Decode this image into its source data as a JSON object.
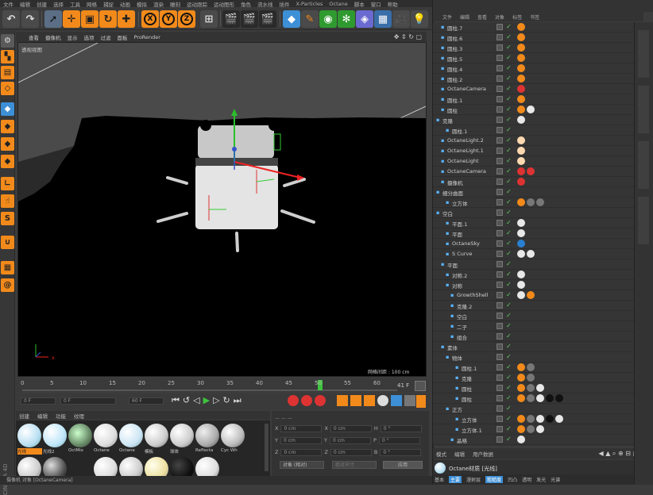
{
  "menubar": {
    "items": [
      "文件",
      "编辑",
      "创建",
      "选择",
      "工具",
      "网格",
      "捕捉",
      "动画",
      "模拟",
      "渲染",
      "雕刻",
      "运动跟踪",
      "运动图形",
      "角色",
      "流水线",
      "插件",
      "X-Particles",
      "Octane",
      "脚本",
      "窗口",
      "帮助"
    ],
    "layout_label": "界面",
    "layout_value": "启动"
  },
  "viewport": {
    "menu": [
      "查看",
      "摄像机",
      "显示",
      "选项",
      "过滤",
      "面板",
      "ProRender"
    ],
    "name": "透视视图",
    "grid_label": "网格间距 : 100 cm"
  },
  "timeline": {
    "ticks": [
      "0",
      "5",
      "10",
      "15",
      "20",
      "25",
      "30",
      "35",
      "40",
      "45",
      "50",
      "55",
      "60"
    ],
    "current_frame": "41 F",
    "start": "0 F",
    "min": "0 F",
    "max": "60 F",
    "end": "60 F"
  },
  "materials": {
    "tabs": [
      "创建",
      "编辑",
      "功能",
      "纹理"
    ],
    "row1": [
      "光线",
      "光线2",
      "OctMix",
      "Octane",
      "Octane",
      "模板",
      "球体",
      "Reflecta",
      "Cyc Wh"
    ]
  },
  "coords": {
    "rows": [
      {
        "a": "X",
        "v1": "0 cm",
        "b": "X",
        "v2": "0 cm",
        "c": "H",
        "v3": "0 °"
      },
      {
        "a": "Y",
        "v1": "0 cm",
        "b": "Y",
        "v2": "0 cm",
        "c": "P",
        "v3": "0 °"
      },
      {
        "a": "Z",
        "v1": "0 cm",
        "b": "Z",
        "v2": "0 cm",
        "c": "B",
        "v3": "0 °"
      }
    ],
    "mode": "对象 (相对)",
    "size_mode": "绝对尺寸",
    "apply": "应用"
  },
  "objects": {
    "menu": [
      "文件",
      "编辑",
      "查看",
      "对象",
      "标签",
      "书签"
    ],
    "rows": [
      {
        "name": "圆柱.7",
        "indent": 8,
        "tags": "o"
      },
      {
        "name": "圆柱.6",
        "indent": 8,
        "tags": "o"
      },
      {
        "name": "圆柱.3",
        "indent": 8,
        "tags": "o"
      },
      {
        "name": "圆柱.5",
        "indent": 8,
        "tags": "o"
      },
      {
        "name": "圆柱.4",
        "indent": 8,
        "tags": "o"
      },
      {
        "name": "圆柱.2",
        "indent": 8,
        "tags": "o"
      },
      {
        "name": "OctaneCamera",
        "indent": 8,
        "tags": "r"
      },
      {
        "name": "圆柱.1",
        "indent": 8,
        "tags": "o"
      },
      {
        "name": "圆柱",
        "indent": 8,
        "tags": "ow"
      },
      {
        "name": "克隆",
        "indent": 2,
        "tags": "w"
      },
      {
        "name": "圆柱.1",
        "indent": 14,
        "tags": ""
      },
      {
        "name": "OctaneLight.2",
        "indent": 8,
        "tags": "l"
      },
      {
        "name": "OctaneLight.1",
        "indent": 8,
        "tags": "l"
      },
      {
        "name": "OctaneLight",
        "indent": 8,
        "tags": "l"
      },
      {
        "name": "OctaneCamera",
        "indent": 8,
        "tags": "rr"
      },
      {
        "name": "摄像机",
        "indent": 8,
        "tags": "r"
      },
      {
        "name": "细分曲面",
        "indent": 2,
        "tags": ""
      },
      {
        "name": "立方体",
        "indent": 14,
        "tags": "ogg"
      },
      {
        "name": "空白",
        "indent": 2,
        "tags": ""
      },
      {
        "name": "平面.1",
        "indent": 14,
        "tags": "w"
      },
      {
        "name": "平面",
        "indent": 14,
        "tags": "w"
      },
      {
        "name": "OctaneSky",
        "indent": 14,
        "tags": "b"
      },
      {
        "name": "S Curve",
        "indent": 14,
        "tags": "ww"
      },
      {
        "name": "平面",
        "indent": 8,
        "tags": ""
      },
      {
        "name": "对称.2",
        "indent": 14,
        "tags": "w"
      },
      {
        "name": "对称",
        "indent": 14,
        "tags": "w"
      },
      {
        "name": "GrowthShell",
        "indent": 20,
        "tags": "wo"
      },
      {
        "name": "克隆.2",
        "indent": 20,
        "tags": ""
      },
      {
        "name": "空白",
        "indent": 20,
        "tags": ""
      },
      {
        "name": "二子",
        "indent": 20,
        "tags": ""
      },
      {
        "name": "组合",
        "indent": 20,
        "tags": ""
      },
      {
        "name": "素体",
        "indent": 8,
        "tags": ""
      },
      {
        "name": "物体",
        "indent": 14,
        "tags": ""
      },
      {
        "name": "圆柱.1",
        "indent": 26,
        "tags": "og"
      },
      {
        "name": "克隆",
        "indent": 26,
        "tags": "og"
      },
      {
        "name": "圆柱",
        "indent": 26,
        "tags": "ogw"
      },
      {
        "name": "圆柱",
        "indent": 26,
        "tags": "ogwkk"
      },
      {
        "name": "正方",
        "indent": 14,
        "tags": ""
      },
      {
        "name": "立方体",
        "indent": 26,
        "tags": "ogwkw"
      },
      {
        "name": "立方体.1",
        "indent": 26,
        "tags": "ogw"
      },
      {
        "name": "晶格",
        "indent": 20,
        "tags": "w"
      }
    ]
  },
  "attributes": {
    "tabs": [
      "模式",
      "编辑",
      "用户数据"
    ],
    "material_name": "Octane材质 [光线]",
    "bottom_tabs": [
      "基本",
      "主要",
      "漫射层",
      "粗糙度",
      "凹凸",
      "透明",
      "发光",
      "光谱",
      "法线",
      "置换"
    ]
  },
  "status": {
    "text": "摄像机 对象 [OctaneCamera]"
  },
  "colors": {
    "accent": "#f28a1b",
    "active_blue": "#3d8fd6",
    "keyframe_green": "#3ec43e"
  }
}
